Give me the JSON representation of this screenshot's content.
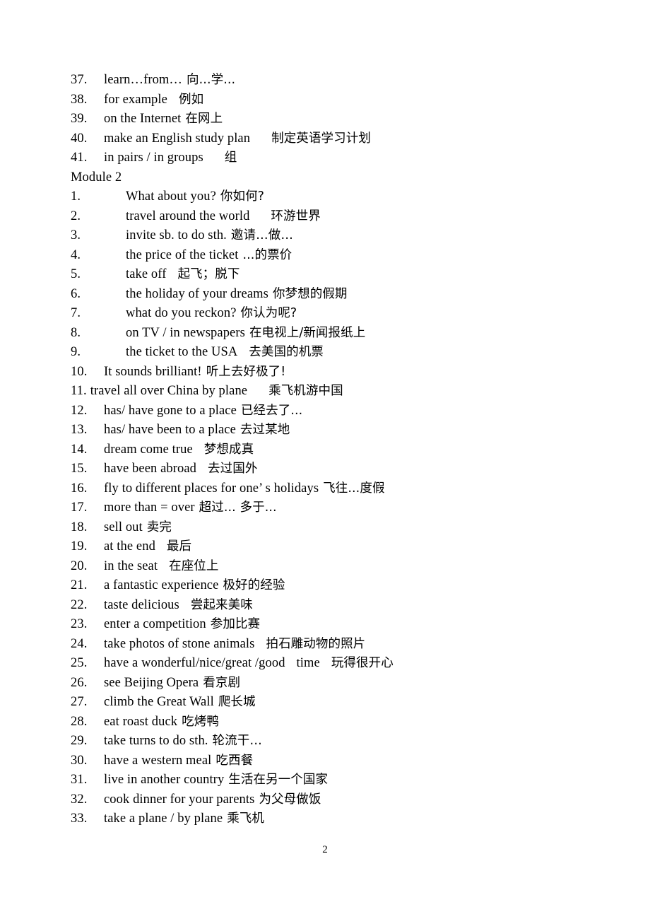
{
  "document": {
    "page_number": "2",
    "sections": [
      {
        "id": "module-1-continued",
        "heading": null,
        "indent_style": "normal",
        "items": [
          {
            "num": "37.",
            "en": "learn…from…",
            "gap": "gap-s",
            "cn": "向...学..."
          },
          {
            "num": "38.",
            "en": "for example",
            "gap": "gap-m",
            "cn": "例如"
          },
          {
            "num": "39.",
            "en": "on the Internet",
            "gap": "gap-s",
            "cn": "在网上"
          },
          {
            "num": "40.",
            "en": "make an English study plan",
            "gap": "gap-l",
            "cn": "制定英语学习计划"
          },
          {
            "num": "41.",
            "en": "in pairs / in groups",
            "gap": "gap-l",
            "cn": "组"
          }
        ]
      },
      {
        "id": "module-2",
        "heading": "Module 2",
        "indent_style": "mixed",
        "items": [
          {
            "num": "1.",
            "indent": true,
            "en": "What about you?",
            "gap": "gap-s",
            "cn": "你如何?"
          },
          {
            "num": "2.",
            "indent": true,
            "en": "travel around the world",
            "gap": "gap-l",
            "cn": "环游世界"
          },
          {
            "num": "3.",
            "indent": true,
            "en": "invite sb. to do sth.",
            "gap": "gap-s",
            "cn": "邀请…做…"
          },
          {
            "num": "4.",
            "indent": true,
            "en": "the price of the ticket",
            "gap": "gap-s",
            "cn": "...的票价"
          },
          {
            "num": "5.",
            "indent": true,
            "en": "take off",
            "gap": "gap-m",
            "cn": "起飞；脱下"
          },
          {
            "num": "6.",
            "indent": true,
            "en": "the holiday of your dreams",
            "gap": "gap-s",
            "cn": "你梦想的假期"
          },
          {
            "num": "7.",
            "indent": true,
            "en": "what do you reckon?",
            "gap": "gap-s",
            "cn": "你认为呢?"
          },
          {
            "num": "8.",
            "indent": true,
            "en": "on TV / in newspapers",
            "gap": "gap-s",
            "cn": "在电视上/新闻报纸上"
          },
          {
            "num": "9.",
            "indent": true,
            "en": "the ticket to the USA",
            "gap": "gap-m",
            "cn": "去美国的机票"
          },
          {
            "num": "10.",
            "en": "It sounds brilliant!",
            "gap": "gap-s",
            "cn": "听上去好极了!"
          },
          {
            "num": "11.",
            "tight": true,
            "en": "travel all over China by plane",
            "gap": "gap-l",
            "cn": "乘飞机游中国"
          },
          {
            "num": "12.",
            "en": "has/ have gone to a place",
            "gap": "gap-s",
            "cn": "已经去了..."
          },
          {
            "num": "13.",
            "en": "has/ have been to a place",
            "gap": "gap-s",
            "cn": "去过某地"
          },
          {
            "num": "14.",
            "en": "dream come true",
            "gap": "gap-m",
            "cn": "梦想成真"
          },
          {
            "num": "15.",
            "en": "have been abroad",
            "gap": "gap-m",
            "cn": "去过国外"
          },
          {
            "num": "16.",
            "en": "fly to different places for one’ s holidays",
            "gap": "gap-s",
            "cn": "飞往...度假"
          },
          {
            "num": "17.",
            "en": "more than = over",
            "gap": "gap-s",
            "cn": "超过... 多于..."
          },
          {
            "num": "18.",
            "en": "sell out",
            "gap": "gap-s",
            "cn": "卖完"
          },
          {
            "num": "19.",
            "en": "at the end",
            "gap": "gap-m",
            "cn": "最后"
          },
          {
            "num": "20.",
            "en": "in the seat",
            "gap": "gap-m",
            "cn": "在座位上"
          },
          {
            "num": "21.",
            "en": "a fantastic experience",
            "gap": "gap-s",
            "cn": "极好的经验"
          },
          {
            "num": "22.",
            "en": "taste delicious",
            "gap": "gap-m",
            "cn": "尝起来美味"
          },
          {
            "num": "23.",
            "en": "enter a competition",
            "gap": "gap-s",
            "cn": "参加比赛"
          },
          {
            "num": "24.",
            "en": "take photos of stone animals",
            "gap": "gap-m",
            "cn": "拍石雕动物的照片"
          },
          {
            "num": "25.",
            "en": "have a wonderful/nice/great /good",
            "gap": "gap-m",
            "en2": "time",
            "gap2": "gap-m",
            "cn": "玩得很开心"
          },
          {
            "num": "26.",
            "en": "see Beijing Opera",
            "gap": "gap-s",
            "cn": "看京剧"
          },
          {
            "num": "27.",
            "en": "climb the Great Wall",
            "gap": "gap-s",
            "cn": "爬长城"
          },
          {
            "num": "28.",
            "en": "eat roast duck",
            "gap": "gap-s",
            "cn": "吃烤鸭"
          },
          {
            "num": "29.",
            "en": "take turns to do sth.",
            "gap": "gap-s",
            "cn": "轮流干…"
          },
          {
            "num": "30.",
            "en": "have a western meal",
            "gap": "gap-s",
            "cn": "吃西餐"
          },
          {
            "num": "31.",
            "en": "live in another country",
            "gap": "gap-s",
            "cn": "生活在另一个国家"
          },
          {
            "num": "32.",
            "en": "cook dinner for your parents",
            "gap": "gap-s",
            "cn": "为父母做饭"
          },
          {
            "num": "33.",
            "en": "take a plane / by plane",
            "gap": "gap-s",
            "cn": "乘飞机"
          }
        ]
      }
    ]
  }
}
